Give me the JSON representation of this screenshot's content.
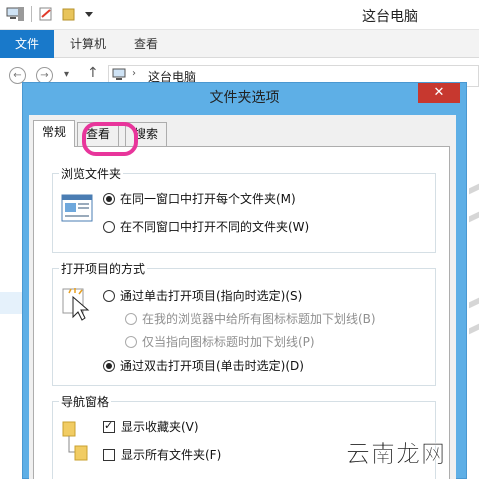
{
  "window": {
    "title": "这台电脑"
  },
  "ribbon": {
    "tabs": [
      "文件",
      "计算机",
      "查看"
    ]
  },
  "address": {
    "path": "这台电脑"
  },
  "dialog": {
    "title": "文件夹选项",
    "close_icon": "✕",
    "tabs": [
      "常规",
      "查看",
      "搜索"
    ],
    "browse": {
      "title": "浏览文件夹",
      "options": [
        "在同一窗口中打开每个文件夹(M)",
        "在不同窗口中打开不同的文件夹(W)"
      ],
      "selected": 0
    },
    "click": {
      "title": "打开项目的方式",
      "options": [
        "通过单击打开项目(指向时选定)(S)",
        "在我的浏览器中给所有图标标题加下划线(B)",
        "仅当指向图标标题时加下划线(P)",
        "通过双击打开项目(单击时选定)(D)"
      ],
      "selected": 3
    },
    "nav": {
      "title": "导航窗格",
      "options": [
        "显示收藏夹(V)",
        "显示所有文件夹(F)"
      ],
      "checked": [
        true,
        false
      ]
    }
  },
  "watermark": "云南龙网",
  "colors": {
    "accent": "#1979ca",
    "dialog_frame": "#5eafe6",
    "close": "#c7382f",
    "highlight": "#e8359b"
  }
}
